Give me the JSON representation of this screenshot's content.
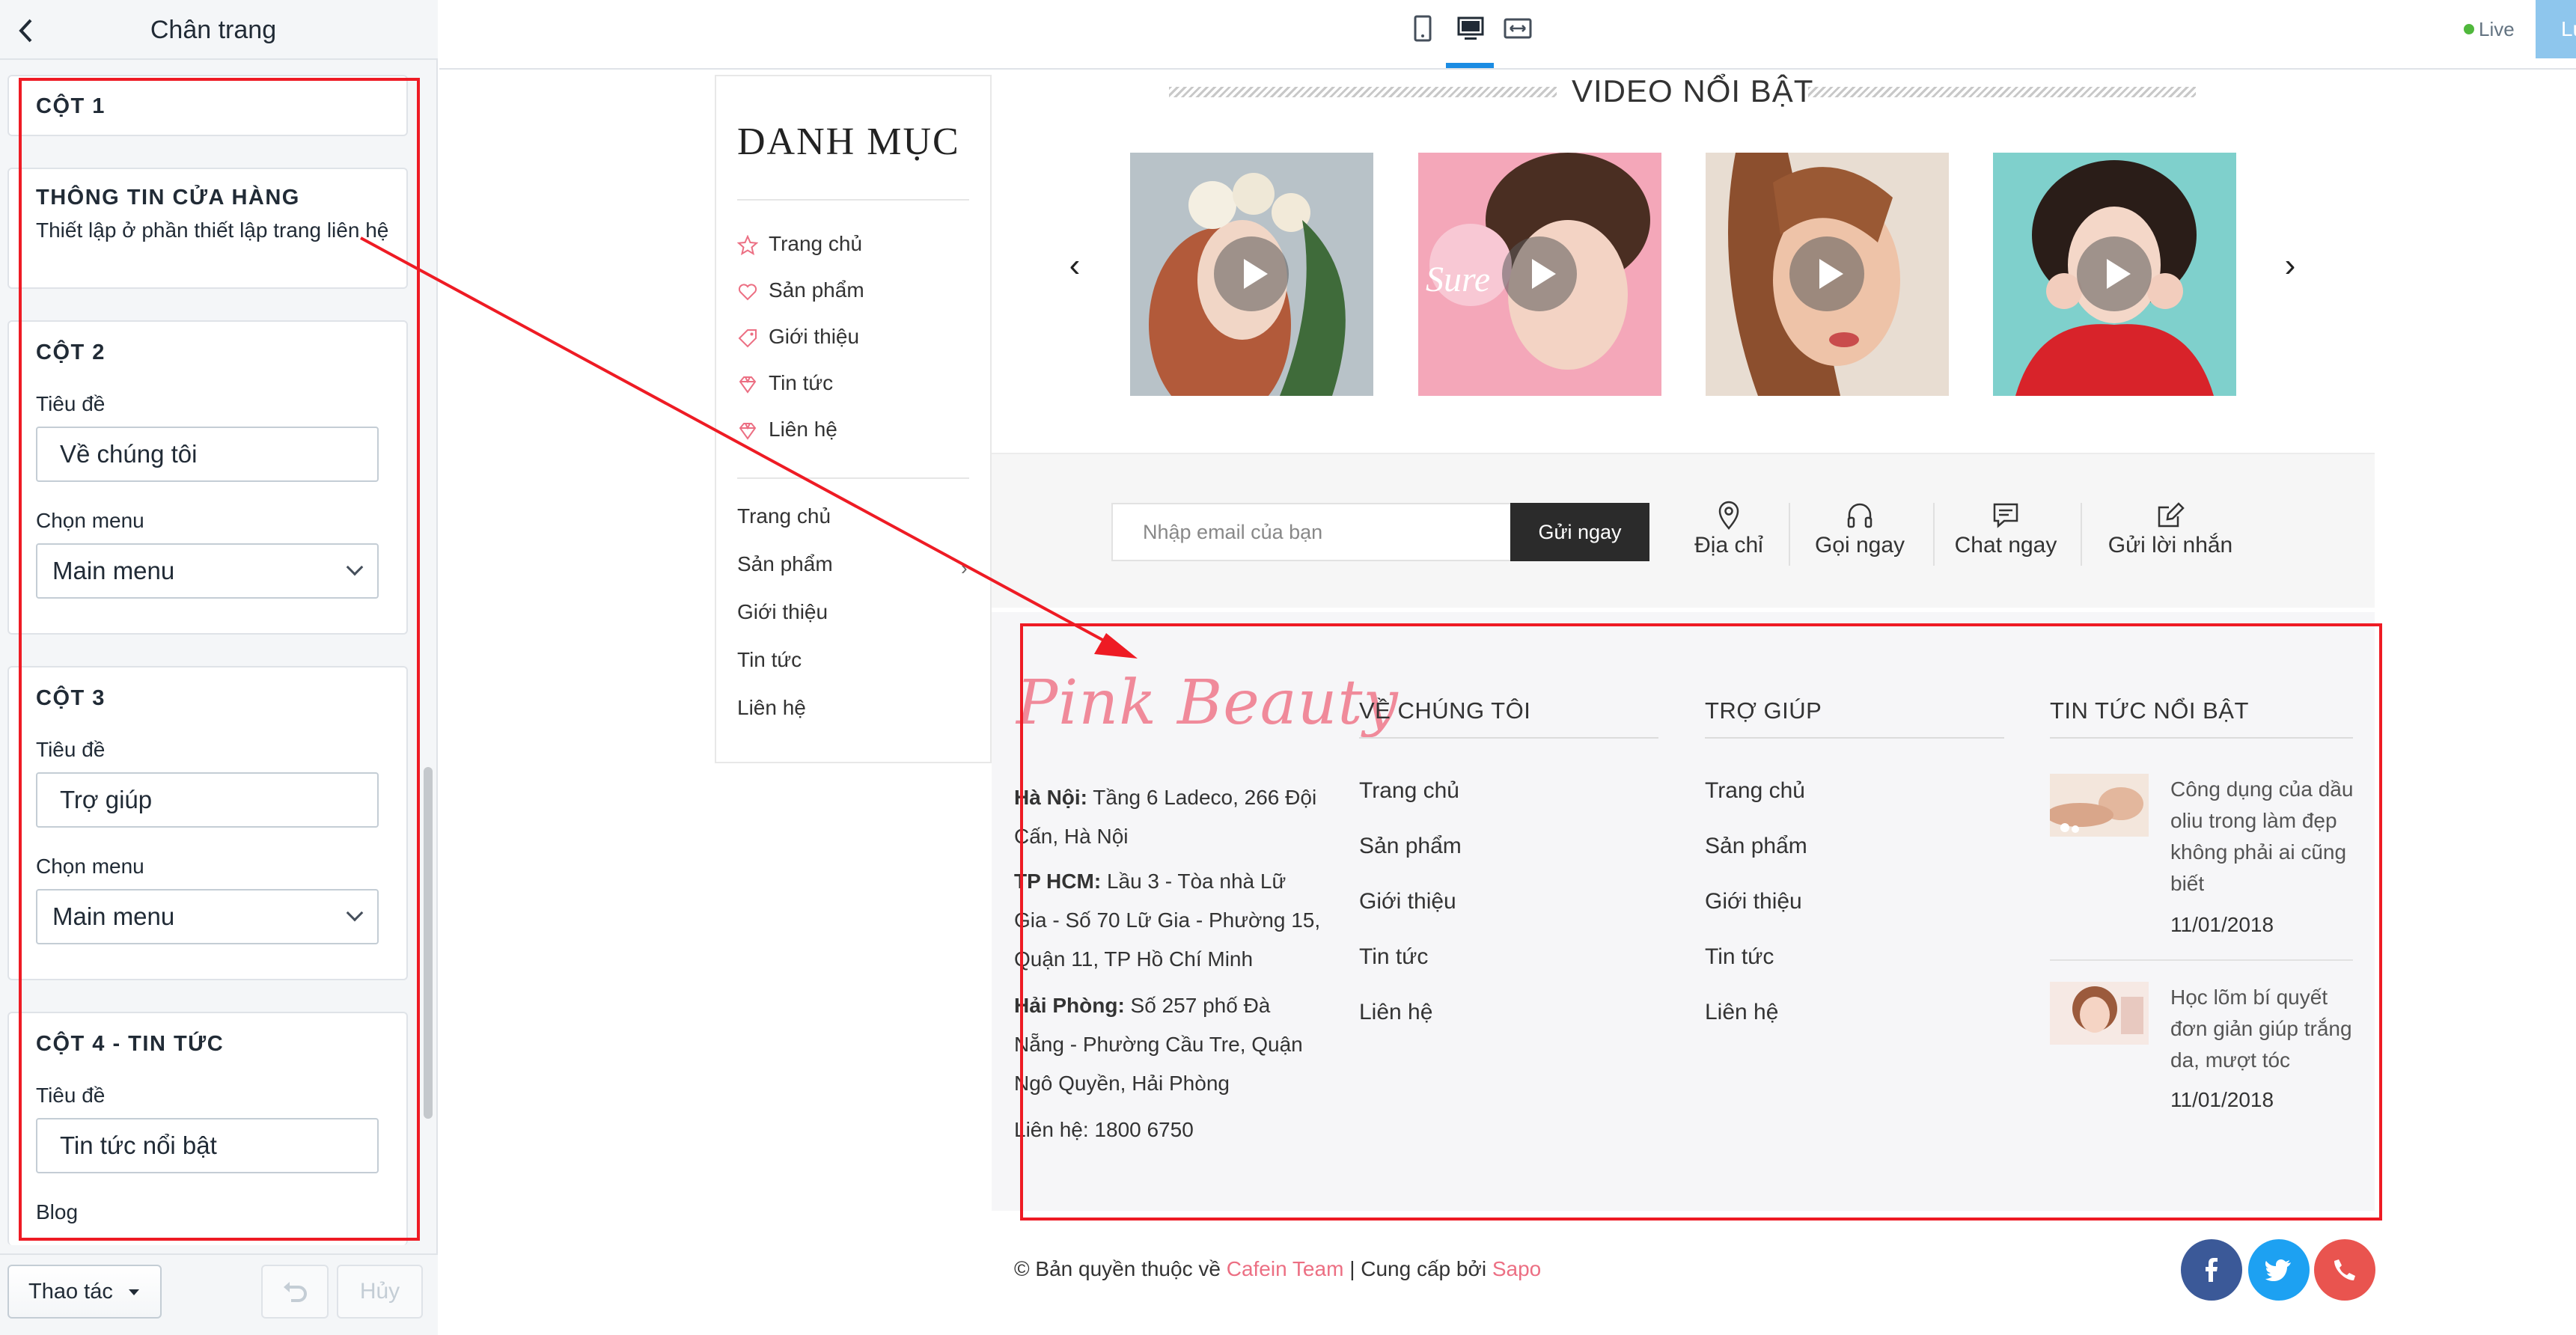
{
  "panel": {
    "title": "Chân trang",
    "back_icon": "chevron-left-icon",
    "col1": {
      "title": "CỘT 1"
    },
    "store_info": {
      "title": "THÔNG TIN CỬA HÀNG",
      "desc": "Thiết lập ở phần thiết lập trang liên hệ"
    },
    "col2": {
      "title": "CỘT 2",
      "title_label": "Tiêu đề",
      "title_value": "Về chúng tôi",
      "menu_label": "Chọn menu",
      "menu_value": "Main menu"
    },
    "col3": {
      "title": "CỘT 3",
      "title_label": "Tiêu đề",
      "title_value": "Trợ giúp",
      "menu_label": "Chọn menu",
      "menu_value": "Main menu"
    },
    "col4": {
      "title": "CỘT 4 - TIN TỨC",
      "title_label": "Tiêu đề",
      "title_value": "Tin tức nổi bật",
      "blog_label": "Blog"
    },
    "footer": {
      "actions": "Thao tác",
      "cancel": "Hủy"
    }
  },
  "topbar": {
    "devices": [
      "mobile-icon",
      "desktop-icon",
      "fullwidth-icon"
    ],
    "active_device": "desktop",
    "live": "Live",
    "save": "Lưu",
    "accent": "#1b8ce3"
  },
  "sidebar_category": {
    "title": "DANH MỤC",
    "items": [
      {
        "icon": "star-icon",
        "label": "Trang chủ"
      },
      {
        "icon": "heart-icon",
        "label": "Sản phẩm"
      },
      {
        "icon": "tag-icon",
        "label": "Giới thiệu"
      },
      {
        "icon": "diamond-icon",
        "label": "Tin tức"
      },
      {
        "icon": "diamond-icon",
        "label": "Liên hệ"
      }
    ],
    "links": [
      "Trang chủ",
      "Sản phẩm",
      "Giới thiệu",
      "Tin tức",
      "Liên hệ"
    ]
  },
  "video": {
    "title": "VIDEO NỔI BẬT",
    "prev": "‹",
    "next": "›"
  },
  "newsletter": {
    "placeholder": "Nhập email của bạn",
    "button": "Gửi ngay",
    "contacts": [
      {
        "icon": "map-pin-icon",
        "label": "Địa chỉ"
      },
      {
        "icon": "headphones-icon",
        "label": "Gọi ngay"
      },
      {
        "icon": "chat-icon",
        "label": "Chat ngay"
      },
      {
        "icon": "edit-icon",
        "label": "Gửi lời nhắn"
      }
    ]
  },
  "footer": {
    "logo": "Pink Beauty",
    "brand_color": "#f08a9a",
    "addresses": [
      {
        "city": "Hà Nội:",
        "text": "Tầng 6 Ladeco, 266 Đội Cấn, Hà Nội"
      },
      {
        "city": "TP HCM:",
        "text": "Lầu 3 - Tòa nhà Lữ Gia - Số 70 Lữ Gia - Phường 15, Quận 11, TP Hồ Chí Minh"
      },
      {
        "city": "Hải Phòng:",
        "text": "Số 257 phố Đà Nẵng - Phường Cầu Tre, Quận Ngô Quyền, Hải Phòng"
      }
    ],
    "hotline": "Liên hệ: 1800 6750",
    "col2": {
      "title": "VỀ CHÚNG TÔI",
      "links": [
        "Trang chủ",
        "Sản phẩm",
        "Giới thiệu",
        "Tin tức",
        "Liên hệ"
      ]
    },
    "col3": {
      "title": "TRỢ GIÚP",
      "links": [
        "Trang chủ",
        "Sản phẩm",
        "Giới thiệu",
        "Tin tức",
        "Liên hệ"
      ]
    },
    "col4": {
      "title": "TIN TỨC NỔI BẬT",
      "articles": [
        {
          "title": "Công dụng của dầu oliu trong làm đẹp không phải ai cũng biết",
          "date": "11/01/2018"
        },
        {
          "title": "Học lõm bí quyết đơn giản giúp trắng da, mượt tóc",
          "date": "11/01/2018"
        }
      ]
    },
    "copyright_prefix": "© Bản quyền thuộc về",
    "copyright_team": "Cafein Team",
    "copyright_mid": "| Cung cấp bởi",
    "copyright_provider": "Sapo",
    "social": [
      {
        "icon": "facebook-icon",
        "color": "#3b5998"
      },
      {
        "icon": "twitter-icon",
        "color": "#1da1f2"
      },
      {
        "icon": "phone-icon",
        "color": "#e9544f"
      }
    ]
  },
  "annotation_color": "#ee1b24"
}
